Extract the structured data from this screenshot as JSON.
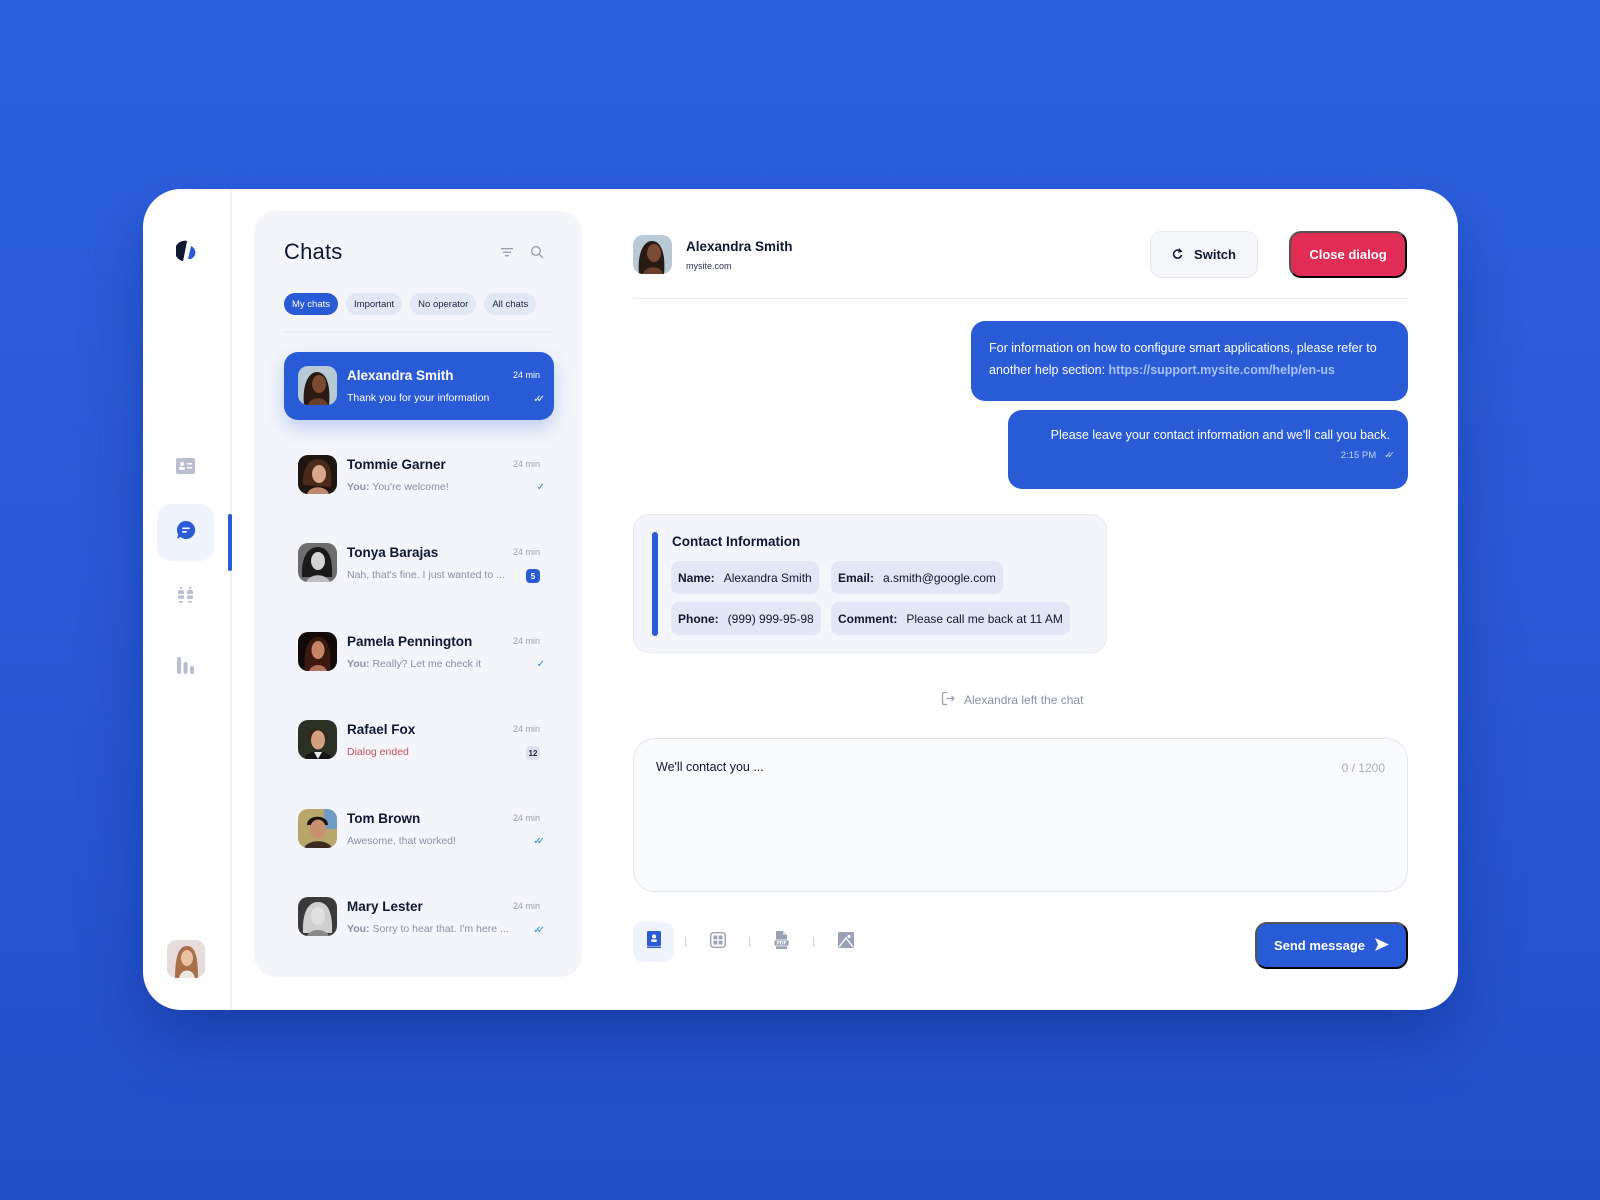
{
  "rail": {
    "logo": "app-logo",
    "items": [
      {
        "name": "contacts",
        "icon": "contact-card-icon",
        "active": false
      },
      {
        "name": "chats",
        "icon": "chat-bubble-icon",
        "active": true
      },
      {
        "name": "operators",
        "icon": "users-sort-icon",
        "active": false
      },
      {
        "name": "analytics",
        "icon": "bar-chart-icon",
        "active": false
      }
    ],
    "user_avatar": "current-user-avatar"
  },
  "chats": {
    "title": "Chats",
    "tools": [
      "filter-icon",
      "search-icon"
    ],
    "tabs": [
      {
        "label": "My chats",
        "active": true
      },
      {
        "label": "Important",
        "active": false
      },
      {
        "label": "No operator",
        "active": false
      },
      {
        "label": "All chats",
        "active": false
      }
    ],
    "items": [
      {
        "name": "Alexandra Smith",
        "time": "24 min",
        "you": "",
        "preview": "Thank you for your information",
        "status": "read",
        "badge": "",
        "active": true
      },
      {
        "name": "Tommie Garner",
        "time": "24 min",
        "you": "You:",
        "preview": "You're welcome!",
        "status": "sent",
        "badge": "",
        "active": false
      },
      {
        "name": "Tonya Barajas",
        "time": "24 min",
        "you": "",
        "preview": "Nah, that's fine. I just wanted to ...",
        "status": "badge-blue",
        "badge": "5",
        "active": false
      },
      {
        "name": "Pamela Pennington",
        "time": "24 min",
        "you": "You:",
        "preview": "Really? Let me check it",
        "status": "sent",
        "badge": "",
        "active": false
      },
      {
        "name": "Rafael Fox",
        "time": "24 min",
        "you": "",
        "preview": "Dialog ended",
        "status": "badge-gray",
        "badge": "12",
        "active": false
      },
      {
        "name": "Tom Brown",
        "time": "24 min",
        "you": "",
        "preview": "Awesome, that worked!",
        "status": "read",
        "badge": "",
        "active": false
      },
      {
        "name": "Mary Lester",
        "time": "24 min",
        "you": "You:",
        "preview": "Sorry to hear that. I'm here ...",
        "status": "read",
        "badge": "",
        "active": false
      }
    ]
  },
  "conversation": {
    "contact_name": "Alexandra Smith",
    "contact_site": "mysite.com",
    "switch_label": "Switch",
    "close_label": "Close dialog",
    "messages": [
      {
        "text": "For information on how to configure smart applications, please refer to another help section: ",
        "link": "https://support.mysite.com/help/en-us"
      },
      {
        "text": "Please leave your contact information and we'll call you back.",
        "time": "2:15 PM",
        "status": "read"
      }
    ],
    "contact_card": {
      "title": "Contact Information",
      "fields": [
        {
          "label": "Name:",
          "value": "Alexandra Smith"
        },
        {
          "label": "Email:",
          "value": "a.smith@google.com"
        },
        {
          "label": "Phone:",
          "value": "(999) 999-95-98"
        },
        {
          "label": "Comment:",
          "value": "Please call me back at 11 AM"
        }
      ]
    },
    "left_notice": "Alexandra left the chat",
    "composer": {
      "value": "We'll contact you ...",
      "counter": "0 / 1200"
    },
    "attachments": [
      "contact-book-icon",
      "template-grid-icon",
      "pdf-file-icon",
      "image-icon"
    ],
    "send_label": "Send message"
  },
  "colors": {
    "accent": "#2a5bd7",
    "danger": "#e12c55",
    "background": "#2d60dd"
  }
}
